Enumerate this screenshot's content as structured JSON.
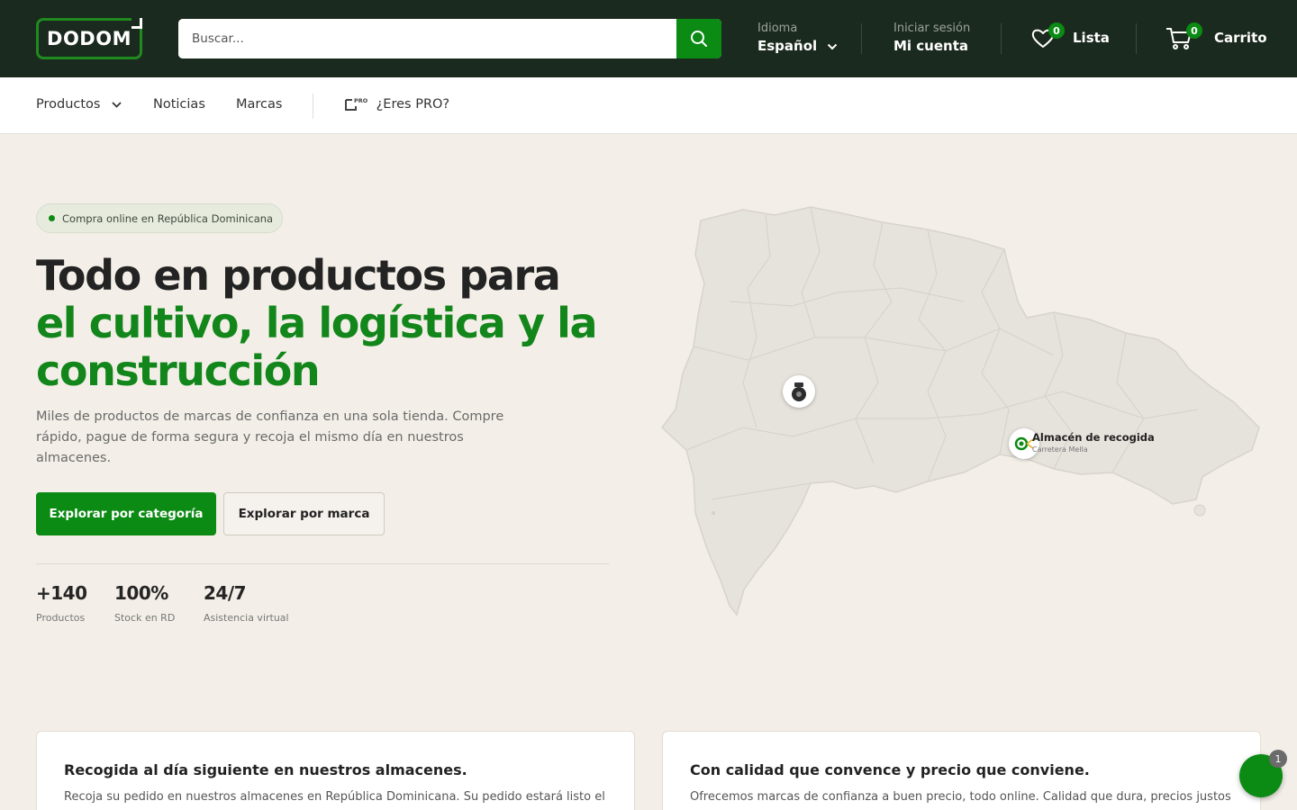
{
  "header": {
    "logo_text": "DODOM",
    "search_placeholder": "Buscar...",
    "language_label": "Idioma",
    "language_value": "Español",
    "account_small": "Iniciar sesión",
    "account_big": "Mi cuenta",
    "wishlist_count": "0",
    "wishlist_label": "Lista",
    "cart_count": "0",
    "cart_label": "Carrito"
  },
  "nav": {
    "products": "Productos",
    "news": "Noticias",
    "brands": "Marcas",
    "pro": "¿Eres PRO?",
    "pro_tag": "PRO"
  },
  "hero": {
    "pill": "Compra online en República Dominicana",
    "title_line1": "Todo en productos para",
    "title_green1": "el cultivo, la logística y la",
    "title_green2": "construcción",
    "lead": "Miles de productos de marcas de confianza en una sola tienda. Compre rápido, pague de forma segura y recoja el mismo día en nuestros almacenes.",
    "btn_category": "Explorar por categoría",
    "btn_brand": "Explorar por marca",
    "stats": [
      {
        "value": "+140",
        "label": "Productos"
      },
      {
        "value": "100%",
        "label": "Stock en RD"
      },
      {
        "value": "24/7",
        "label": "Asistencia virtual"
      }
    ]
  },
  "map": {
    "pickup_label": "Almacén de recogida",
    "pickup_sub": "Carretera Mella"
  },
  "cards": [
    {
      "title": "Recogida al día siguiente en nuestros almacenes.",
      "text": "Recoja su pedido en nuestros almacenes en República Dominicana. Su pedido estará listo el"
    },
    {
      "title": "Con calidad que convence y precio que conviene.",
      "text": "Ofrecemos marcas de confianza a buen precio, todo online. Calidad que dura, precios justos"
    }
  ],
  "chat": {
    "badge": "1"
  },
  "colors": {
    "brand_green": "#0b8a14",
    "header_bg": "#1b2a1e",
    "page_bg": "#f3efe8"
  }
}
